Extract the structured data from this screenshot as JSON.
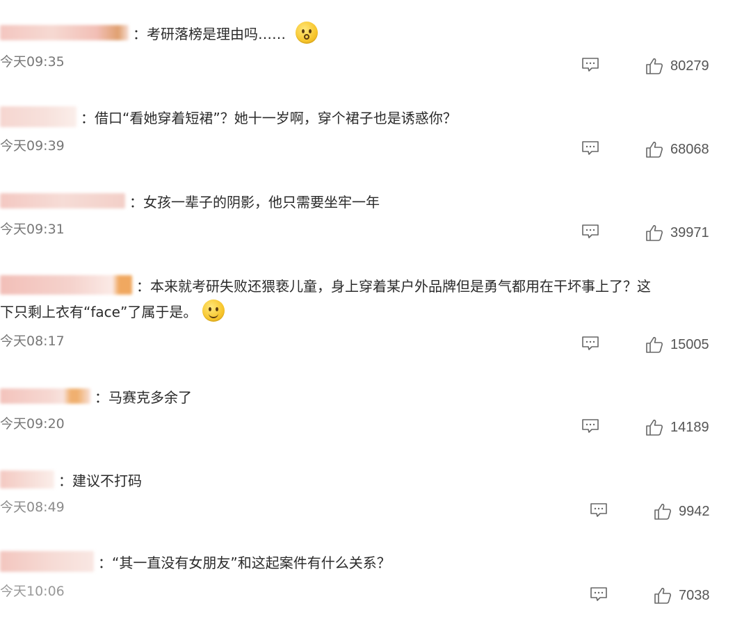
{
  "comments": [
    {
      "text": "：考研落榜是理由吗……",
      "time": "今天09:35",
      "likes": "80279",
      "emoji": "shocked-face",
      "name_colors": [
        "#f4c6c0",
        "#f6d9d2",
        "#f2bfb6",
        "#e0a070"
      ]
    },
    {
      "text": "：借口“看她穿着短裙”？她十一岁啊，穿个裙子也是诱惑你？",
      "time": "今天09:39",
      "likes": "68068",
      "name_colors": [
        "#f6d6d0",
        "#f7e1dc"
      ]
    },
    {
      "text": "：女孩一辈子的阴影，他只需要坐牢一年",
      "time": "今天09:31",
      "likes": "39971",
      "name_colors": [
        "#f4c8c2",
        "#f6dcd6",
        "#f3cfc8"
      ]
    },
    {
      "text": "：本来就考研失败还猥亵儿童，身上穿着某户外品牌但是勇气都用在干坏事上了？这",
      "text2": "下只剩上衣有“face”了属于是。",
      "time": "今天08:17",
      "likes": "15005",
      "emoji": "smile-face",
      "name_colors": [
        "#f2bfb8",
        "#f5d3cd",
        "#f0a860"
      ]
    },
    {
      "text": "：马赛克多余了",
      "time": "今天09:20",
      "likes": "14189",
      "name_colors": [
        "#f3c3bc",
        "#f6d8d2",
        "#f0b070"
      ]
    },
    {
      "text": "：建议不打码",
      "time": "今天08:49",
      "likes": "9942",
      "name_colors": [
        "#f4c9c2",
        "#f7dfd9"
      ]
    },
    {
      "text": "：“其一直没有女朋友”和这起案件有什么关系？",
      "time": "今天10:06",
      "likes": "7038",
      "name_colors": [
        "#f3c6bf",
        "#f6dbd5"
      ]
    }
  ],
  "colors": {
    "icon_stroke": "#666666",
    "time": "#777777",
    "text": "#2a2a2a"
  }
}
